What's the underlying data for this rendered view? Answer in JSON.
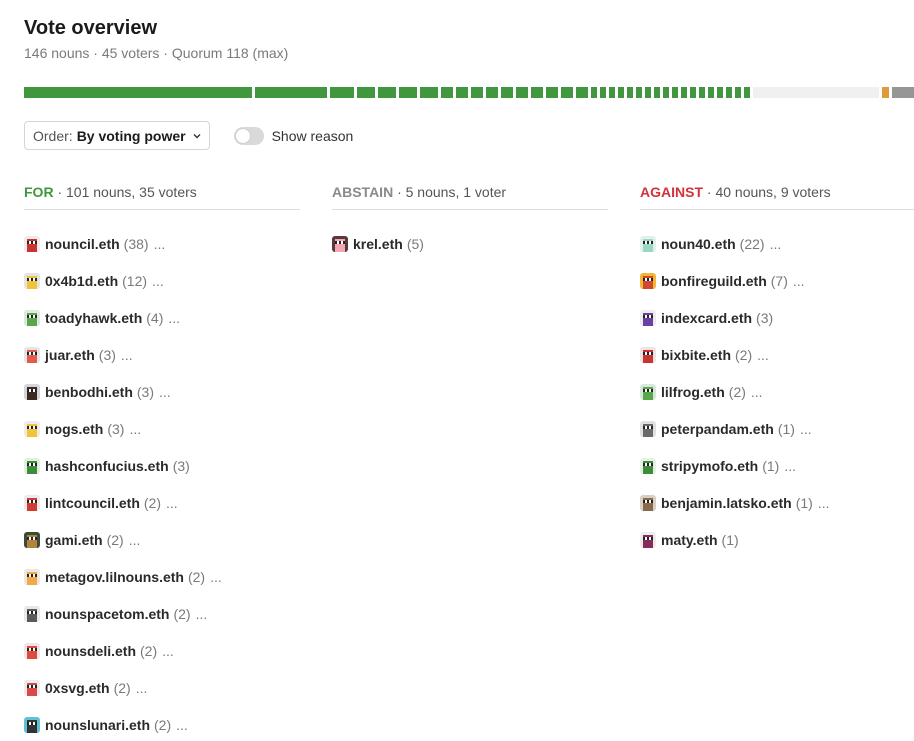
{
  "header": {
    "title": "Vote overview",
    "subtitle": "146 nouns · 45 voters · Quorum 118 (max)"
  },
  "vote_bar": {
    "for_voting_power": [
      38,
      12,
      4,
      3,
      3,
      3,
      3,
      2,
      2,
      2,
      2,
      2,
      2,
      2,
      2,
      2,
      2,
      1,
      1,
      1,
      1,
      1,
      1,
      1,
      1,
      1,
      1,
      1,
      1,
      1,
      1,
      1,
      1,
      1,
      1
    ],
    "abstain_voting_power": [
      5
    ],
    "against_voting_power": [
      1
    ],
    "remaining": 3,
    "colors": {
      "for": "#40973e",
      "abstain": "#f0f0f0",
      "against": "#e09a3e",
      "remaining": "#969696"
    }
  },
  "controls": {
    "order_label": "Order:",
    "order_value": "By voting power",
    "toggle_label": "Show reason",
    "toggle_on": false
  },
  "columns": {
    "for": {
      "heading": "FOR",
      "summary": " · 101 nouns, 35 voters",
      "color": "#40973e",
      "voters": [
        {
          "name": "nouncil.eth",
          "count": "(38)",
          "more": "...",
          "bg": "#f1e9ec",
          "accent": "#c8342f"
        },
        {
          "name": "0x4b1d.eth",
          "count": "(12)",
          "more": "...",
          "bg": "#e3e3e3",
          "accent": "#f2c23b"
        },
        {
          "name": "toadyhawk.eth",
          "count": "(4)",
          "more": "...",
          "bg": "#dfe7df",
          "accent": "#5aa64a"
        },
        {
          "name": "juar.eth",
          "count": "(3)",
          "more": "...",
          "bg": "#e4e4ef",
          "accent": "#e25b4d"
        },
        {
          "name": "benbodhi.eth",
          "count": "(3)",
          "more": "...",
          "bg": "#d6d6d6",
          "accent": "#3a2a22"
        },
        {
          "name": "nogs.eth",
          "count": "(3)",
          "more": "...",
          "bg": "#ececec",
          "accent": "#f2c23b"
        },
        {
          "name": "hashconfucius.eth",
          "count": "(3)",
          "more": "",
          "bg": "#e1efe1",
          "accent": "#3e8d3b"
        },
        {
          "name": "lintcouncil.eth",
          "count": "(2)",
          "more": "...",
          "bg": "#ececec",
          "accent": "#d33a32"
        },
        {
          "name": "gami.eth",
          "count": "(2)",
          "more": "...",
          "bg": "#3c4a3a",
          "accent": "#b3823b"
        },
        {
          "name": "metagov.lilnouns.eth",
          "count": "(2)",
          "more": "...",
          "bg": "#efe7df",
          "accent": "#f0a94b"
        },
        {
          "name": "nounspacetom.eth",
          "count": "(2)",
          "more": "...",
          "bg": "#e8e8e8",
          "accent": "#5a5a5a"
        },
        {
          "name": "nounsdeli.eth",
          "count": "(2)",
          "more": "...",
          "bg": "#f1e5e5",
          "accent": "#e04a3a"
        },
        {
          "name": "0xsvg.eth",
          "count": "(2)",
          "more": "...",
          "bg": "#ececec",
          "accent": "#d84a4a"
        },
        {
          "name": "nounslunari.eth",
          "count": "(2)",
          "more": "...",
          "bg": "#5fc1d6",
          "accent": "#333333"
        }
      ]
    },
    "abstain": {
      "heading": "ABSTAIN",
      "summary": " · 5 nouns, 1 voter",
      "color": "#8a8a8a",
      "voters": [
        {
          "name": "krel.eth",
          "count": "(5)",
          "more": "",
          "bg": "#5a3a38",
          "accent": "#f2a6b3"
        }
      ]
    },
    "against": {
      "heading": "AGAINST",
      "summary": " · 40 nouns, 9 voters",
      "color": "#d6303b",
      "voters": [
        {
          "name": "noun40.eth",
          "count": "(22)",
          "more": "...",
          "bg": "#dff1ea",
          "accent": "#9ad8c2"
        },
        {
          "name": "bonfireguild.eth",
          "count": "(7)",
          "more": "...",
          "bg": "#f2b63b",
          "accent": "#d2452f"
        },
        {
          "name": "indexcard.eth",
          "count": "(3)",
          "more": "",
          "bg": "#ececec",
          "accent": "#6b3fa0"
        },
        {
          "name": "bixbite.eth",
          "count": "(2)",
          "more": "...",
          "bg": "#f1e3e3",
          "accent": "#c8342f"
        },
        {
          "name": "lilfrog.eth",
          "count": "(2)",
          "more": "...",
          "bg": "#d6e8dc",
          "accent": "#5aa64a"
        },
        {
          "name": "peterpandam.eth",
          "count": "(1)",
          "more": "...",
          "bg": "#e1e1e1",
          "accent": "#6a6a6a"
        },
        {
          "name": "stripymofo.eth",
          "count": "(1)",
          "more": "...",
          "bg": "#e6f1e6",
          "accent": "#3e8d3b"
        },
        {
          "name": "benjamin.latsko.eth",
          "count": "(1)",
          "more": "...",
          "bg": "#d8d0c4",
          "accent": "#8a6a4a"
        },
        {
          "name": "maty.eth",
          "count": "(1)",
          "more": "",
          "bg": "#ececec",
          "accent": "#8a2a5a"
        }
      ]
    }
  }
}
